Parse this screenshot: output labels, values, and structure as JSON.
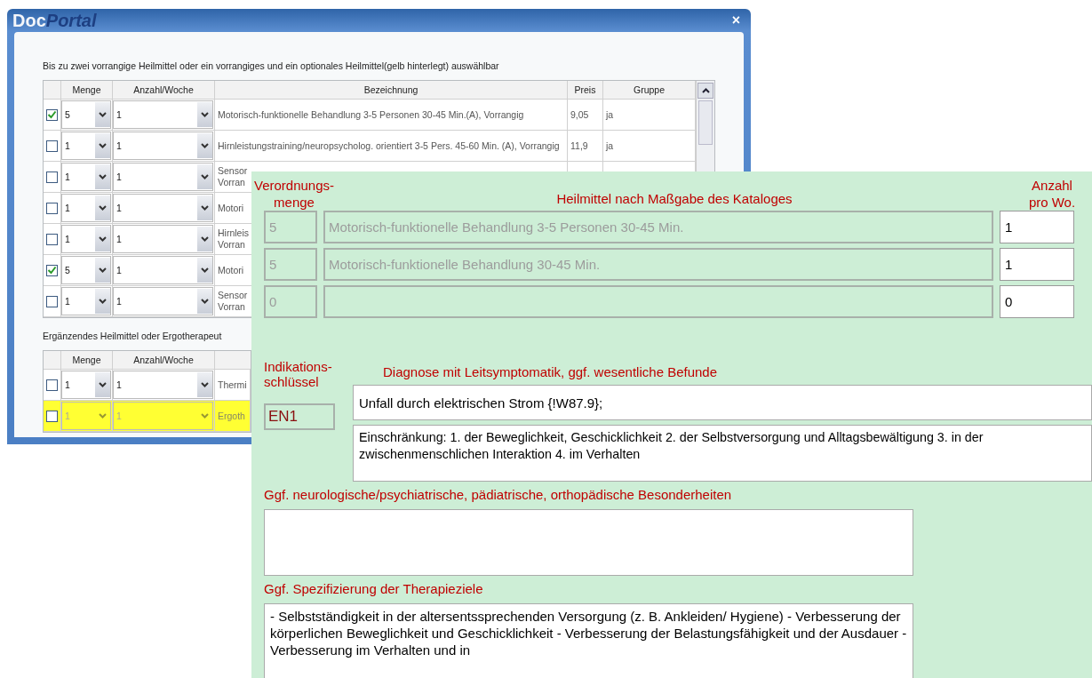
{
  "back_window": {
    "logo": {
      "part_1": "Doc",
      "part_2": "Portal"
    },
    "close": "×",
    "instruction": "Bis zu zwei vorrangige Heilmittel oder ein vorrangiges und ein optionales Heilmittel(gelb hinterlegt) auswählbar",
    "main_table": {
      "columns": [
        "Menge",
        "Anzahl/Woche",
        "Bezeichnung",
        "Preis",
        "Gruppe"
      ],
      "rows": [
        {
          "kind": "full",
          "checked": true,
          "menge": "5",
          "anzahl": "1",
          "bezeichnung": "Motorisch-funktionelle Behandlung 3-5 Personen 30-45 Min.(A), Vorrangig",
          "preis": "9,05",
          "gruppe": "ja"
        },
        {
          "kind": "full",
          "checked": false,
          "menge": "1",
          "anzahl": "1",
          "bezeichnung": "Hirnleistungstraining/neuropsycholog. orientiert  3-5 Pers. 45-60 Min. (A), Vorrangig",
          "preis": "11,9",
          "gruppe": "ja"
        },
        {
          "kind": "covered",
          "checked": false,
          "menge": "1",
          "anzahl": "1",
          "bezeichnung": "Sensor Vorran"
        },
        {
          "kind": "covered",
          "checked": false,
          "menge": "1",
          "anzahl": "1",
          "bezeichnung": "Motori"
        },
        {
          "kind": "covered",
          "checked": false,
          "menge": "1",
          "anzahl": "1",
          "bezeichnung": "Hirnleis Vorran"
        },
        {
          "kind": "covered",
          "checked": true,
          "menge": "5",
          "anzahl": "1",
          "bezeichnung": "Motori"
        },
        {
          "kind": "covered",
          "checked": false,
          "menge": "1",
          "anzahl": "1",
          "bezeichnung": "Sensor Vorran"
        }
      ]
    },
    "supplement_label": "Ergänzendes Heilmittel oder Ergotherapeut",
    "supplement_table": {
      "columns": [
        "Menge",
        "Anzahl/Woche"
      ],
      "rows": [
        {
          "checked": false,
          "optional": false,
          "menge": "1",
          "anzahl": "1",
          "bezeichnung": "Thermi"
        },
        {
          "checked": false,
          "optional": true,
          "menge": "1",
          "anzahl": "1",
          "bezeichnung": "Ergoth"
        }
      ]
    }
  },
  "front_panel": {
    "header": {
      "quantity": [
        "Verordnungs-",
        "menge"
      ],
      "remedy": "Heilmittel nach Maßgabe des Kataloges",
      "per_week": [
        "Anzahl",
        "pro Wo."
      ]
    },
    "remedies": [
      {
        "quantity": "5",
        "name": "Motorisch-funktionelle Behandlung 3-5 Personen 30-45 Min.",
        "per_week": "1"
      },
      {
        "quantity": "5",
        "name": "Motorisch-funktionelle Behandlung 30-45 Min.",
        "per_week": "1"
      },
      {
        "quantity": "0",
        "per_week": "0"
      }
    ],
    "indication_label": [
      "Indikations-",
      "schlüssel"
    ],
    "indication_key": "EN1",
    "diagnosis_label": "Diagnose mit Leitsymptomatik, ggf. wesentliche Befunde",
    "diagnosis": [
      "Unfall durch elektrischen Strom {!W87.9};",
      "Einschränkung: 1. der Beweglichkeit, Geschicklichkeit 2. der Selbstversorgung und Alltagsbewältigung 3. in der zwischenmenschlichen Interaktion 4. im Verhalten"
    ],
    "special_label": "Ggf. neurologische/psychiatrische, pädiatrische, orthopädische Besonderheiten",
    "goals_label": "Ggf. Spezifizierung der Therapieziele",
    "goals": "- Selbstständigkeit in der altersentssprechenden Versorgung (z. B. Ankleiden/ Hygiene) - Verbesserung der körperlichen Beweglichkeit und Geschicklichkeit - Verbesserung der Belastungsfähigkeit und der Ausdauer - Verbesserung im Verhalten und in"
  }
}
